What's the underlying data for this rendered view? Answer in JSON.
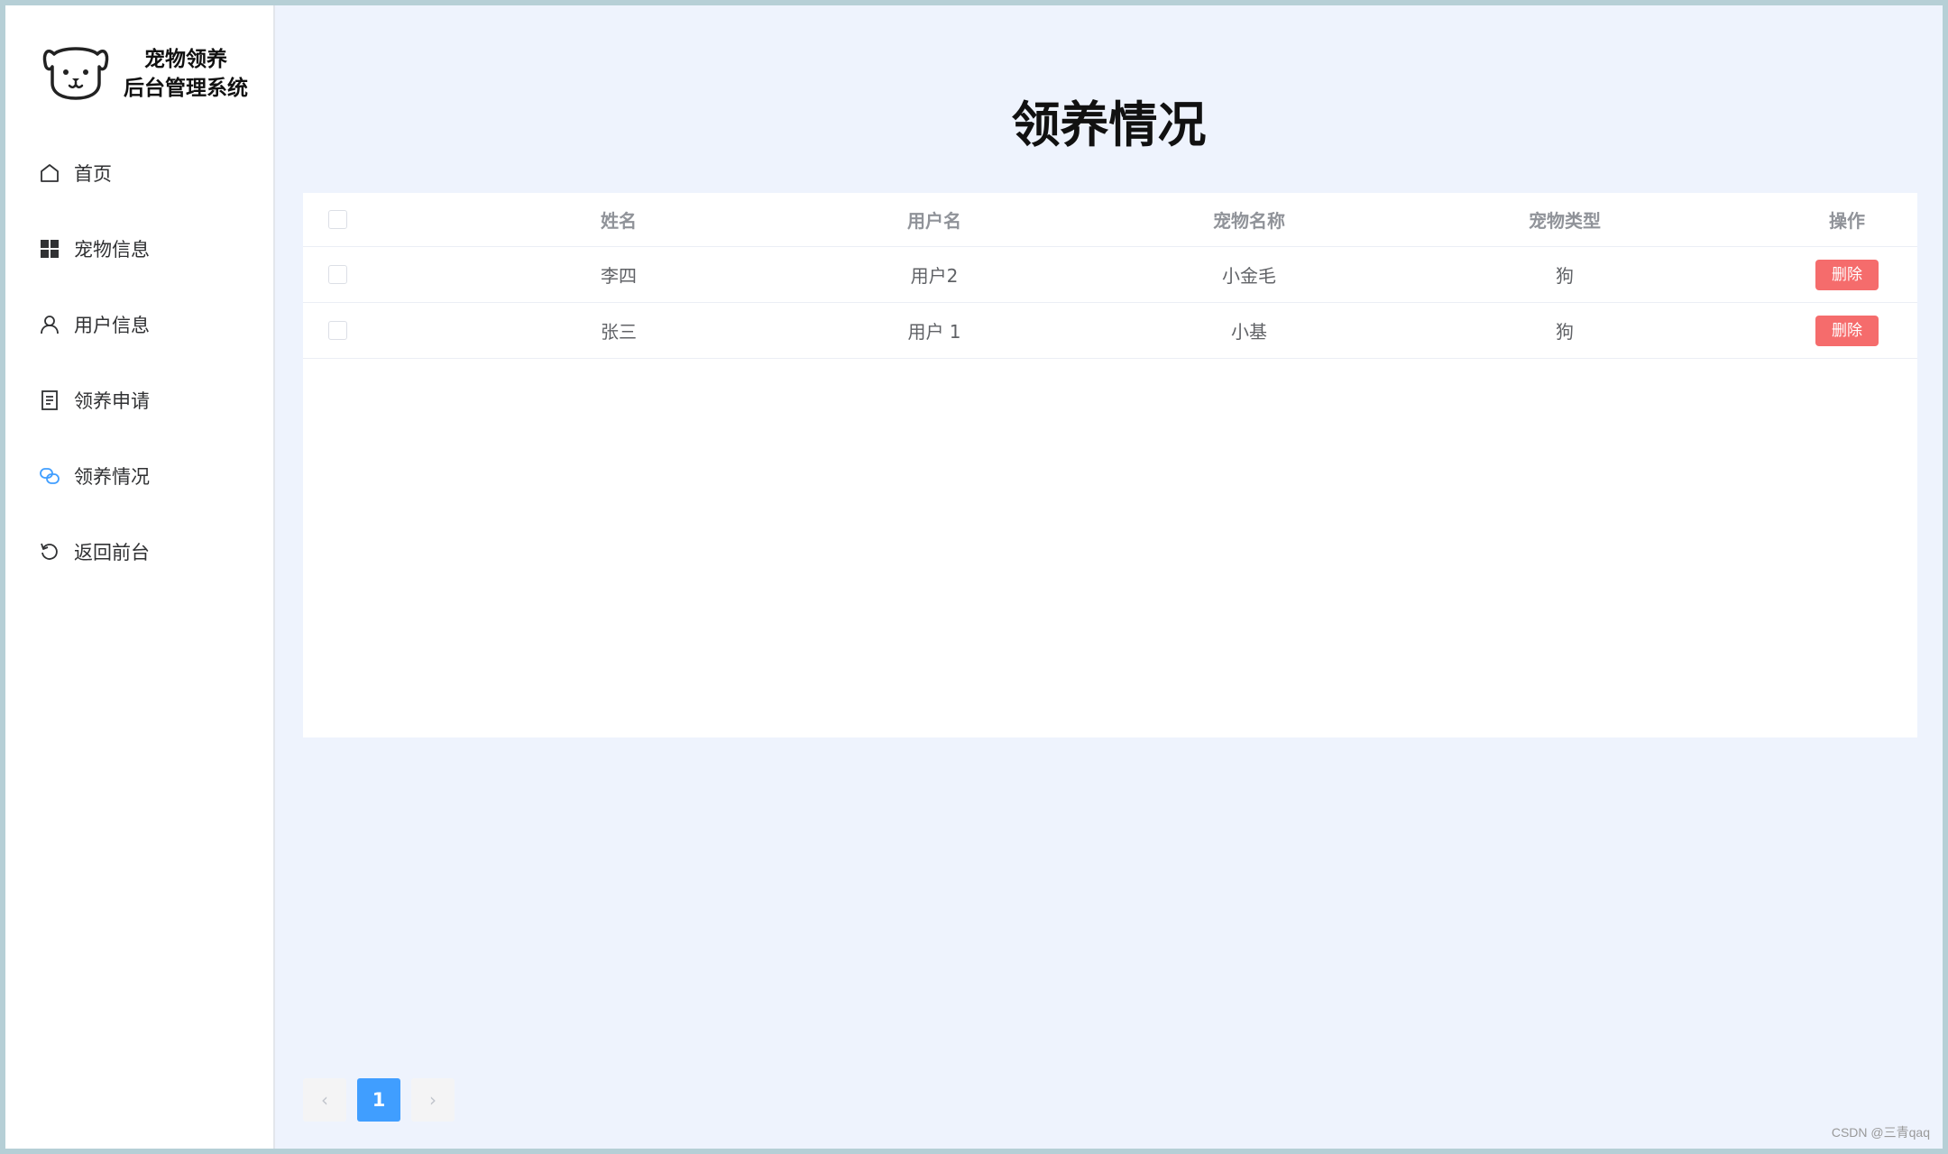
{
  "sidebar": {
    "logo_line1": "宠物领养",
    "logo_line2": "后台管理系统",
    "items": [
      {
        "label": "首页",
        "icon": "home-icon"
      },
      {
        "label": "宠物信息",
        "icon": "grid-icon"
      },
      {
        "label": "用户信息",
        "icon": "user-icon"
      },
      {
        "label": "领养申请",
        "icon": "document-icon"
      },
      {
        "label": "领养情况",
        "icon": "link-icon",
        "active": true
      },
      {
        "label": "返回前台",
        "icon": "refresh-icon"
      }
    ]
  },
  "main": {
    "title": "领养情况",
    "table": {
      "headers": [
        "姓名",
        "用户名",
        "宠物名称",
        "宠物类型",
        "操作"
      ],
      "rows": [
        {
          "name": "李四",
          "username": "用户2",
          "pet_name": "小金毛",
          "pet_type": "狗",
          "action": "删除"
        },
        {
          "name": "张三",
          "username": "用户 1",
          "pet_name": "小基",
          "pet_type": "狗",
          "action": "删除"
        }
      ]
    },
    "pagination": {
      "prev": "‹",
      "current": "1",
      "next": "›"
    }
  },
  "watermark": "CSDN @三青qaq",
  "colors": {
    "accent": "#409eff",
    "danger": "#f56c6c",
    "background": "#eef3fd"
  }
}
